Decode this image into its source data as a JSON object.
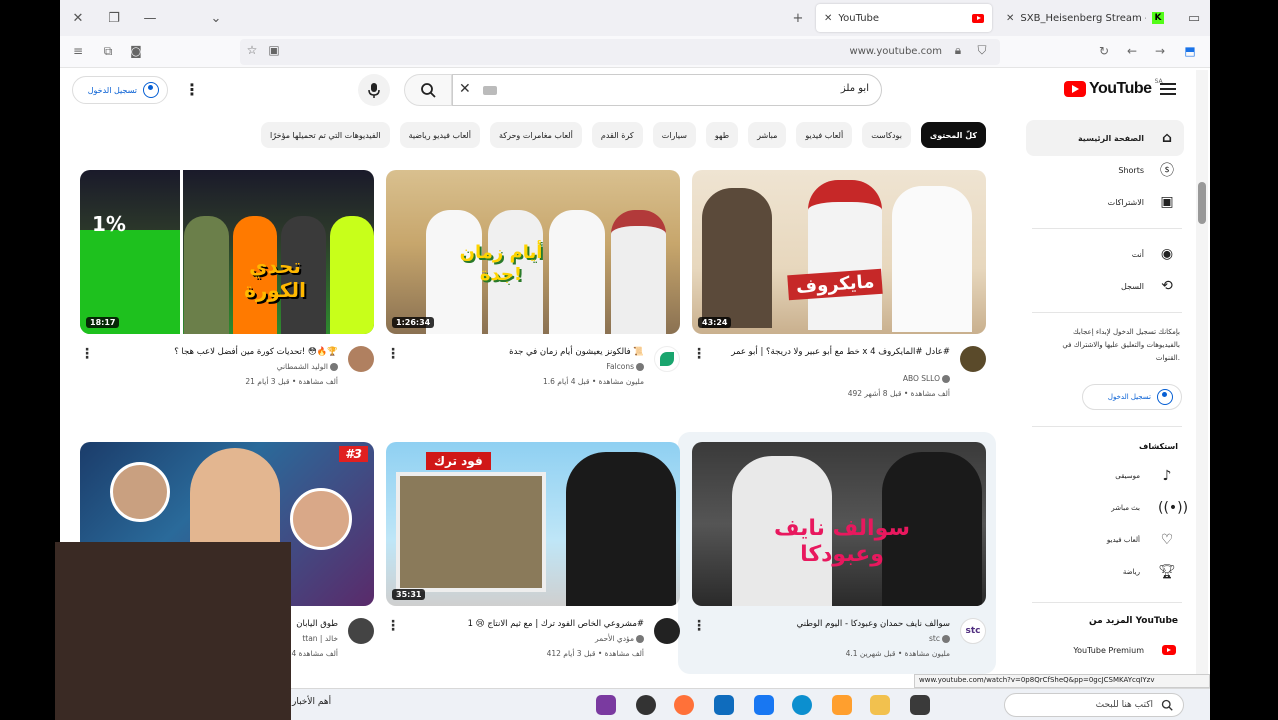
{
  "browser": {
    "tabs": [
      {
        "title": "YouTube",
        "active": true
      },
      {
        "title": "SXB_Heisenberg Stream - Wat",
        "active": false
      }
    ],
    "url": "www.youtube.com"
  },
  "header": {
    "signin_label": "تسجيل الدخول",
    "search_query": "ابو ملز",
    "logo_text": "YouTube",
    "region": "SA"
  },
  "chips": [
    "كلّ المحتوى",
    "بودكاست",
    "ألعاب فيديو",
    "مباشر",
    "طهو",
    "سيارات",
    "كرة القدم",
    "ألعاب مغامرات وحركة",
    "ألعاب فيديو رياضية",
    "الفيديوهات التي تم تحميلها مؤخرًا"
  ],
  "sidebar": {
    "home": "الصفحة الرئيسية",
    "shorts": "Shorts",
    "subscriptions": "الاشتراكات",
    "you": "أنت",
    "history": "السجل",
    "signin_note": "بإمكانك تسجيل الدخول لإبداء إعجابك بالفيديوهات والتعليق عليها والاشتراك في القنوات.",
    "signin_label": "تسجيل الدخول",
    "explore_title": "استكشاف",
    "explore": [
      "موسيقى",
      "بث مباشر",
      "ألعاب فيديو",
      "رياضة"
    ],
    "more_title": "المزيد من YouTube",
    "premium": "YouTube Premium"
  },
  "videos": [
    {
      "title": "خط مع أبو عبير ولا دريجة؟ | أبو عمر x عادل #المايكروف 4#",
      "channel": "ABO SLLO",
      "stats": "492 ألف مشاهدة • قبل 8 أشهر",
      "duration": "43:24",
      "thumb_text": "مايكروف",
      "avatar_color": "#5a4a2a"
    },
    {
      "title": "فالكونز يعيشون أيام زمان في جدة 📜",
      "channel": "Falcons",
      "stats": "1.6 مليون مشاهدة • قبل 4 أيام",
      "duration": "1:26:34",
      "thumb_text": "أيام زمان جدة!",
      "avatar_color": "#1aa56e"
    },
    {
      "title": "تحديات كورة مين أفضل لاعب هجا ؟! 😳🔥🏆",
      "channel": "الوليد الشمطاني",
      "stats": "21 ألف مشاهدة • قبل 3 أيام",
      "duration": "18:17",
      "thumb_text": "تحدي الكورة",
      "avatar_color": "#b08060"
    },
    {
      "title": "سوالف نايف حمدان وعبودكا - اليوم الوطني",
      "channel": "stc",
      "stats": "4.1 مليون مشاهدة • قبل شهرين",
      "duration": "",
      "thumb_text": "سوالف نايف وعبودكا",
      "avatar_color": "#ffffff"
    },
    {
      "title": "مشروعي الخاص الفود ترك | مع ثيم الانتاج 😢 1#",
      "channel": "مؤدي الأحمر",
      "stats": "412 ألف مشاهدة • قبل 3 أيام",
      "duration": "35:31",
      "thumb_text": "فود ترك",
      "avatar_color": "#222222"
    },
    {
      "title": "طوق اليابان",
      "channel": "ttan | خالد",
      "stats": "14 ألف مشاهدة",
      "duration": "",
      "thumb_text": "#3",
      "avatar_color": "#444444"
    }
  ],
  "status_url": "www.youtube.com/watch?v=0p8QrCfSheQ&pp=0gcJCSMKAYcqIYzv",
  "taskbar": {
    "search_placeholder": "اكتب هنا للبحث",
    "news_label": "أهم الأخبار"
  }
}
